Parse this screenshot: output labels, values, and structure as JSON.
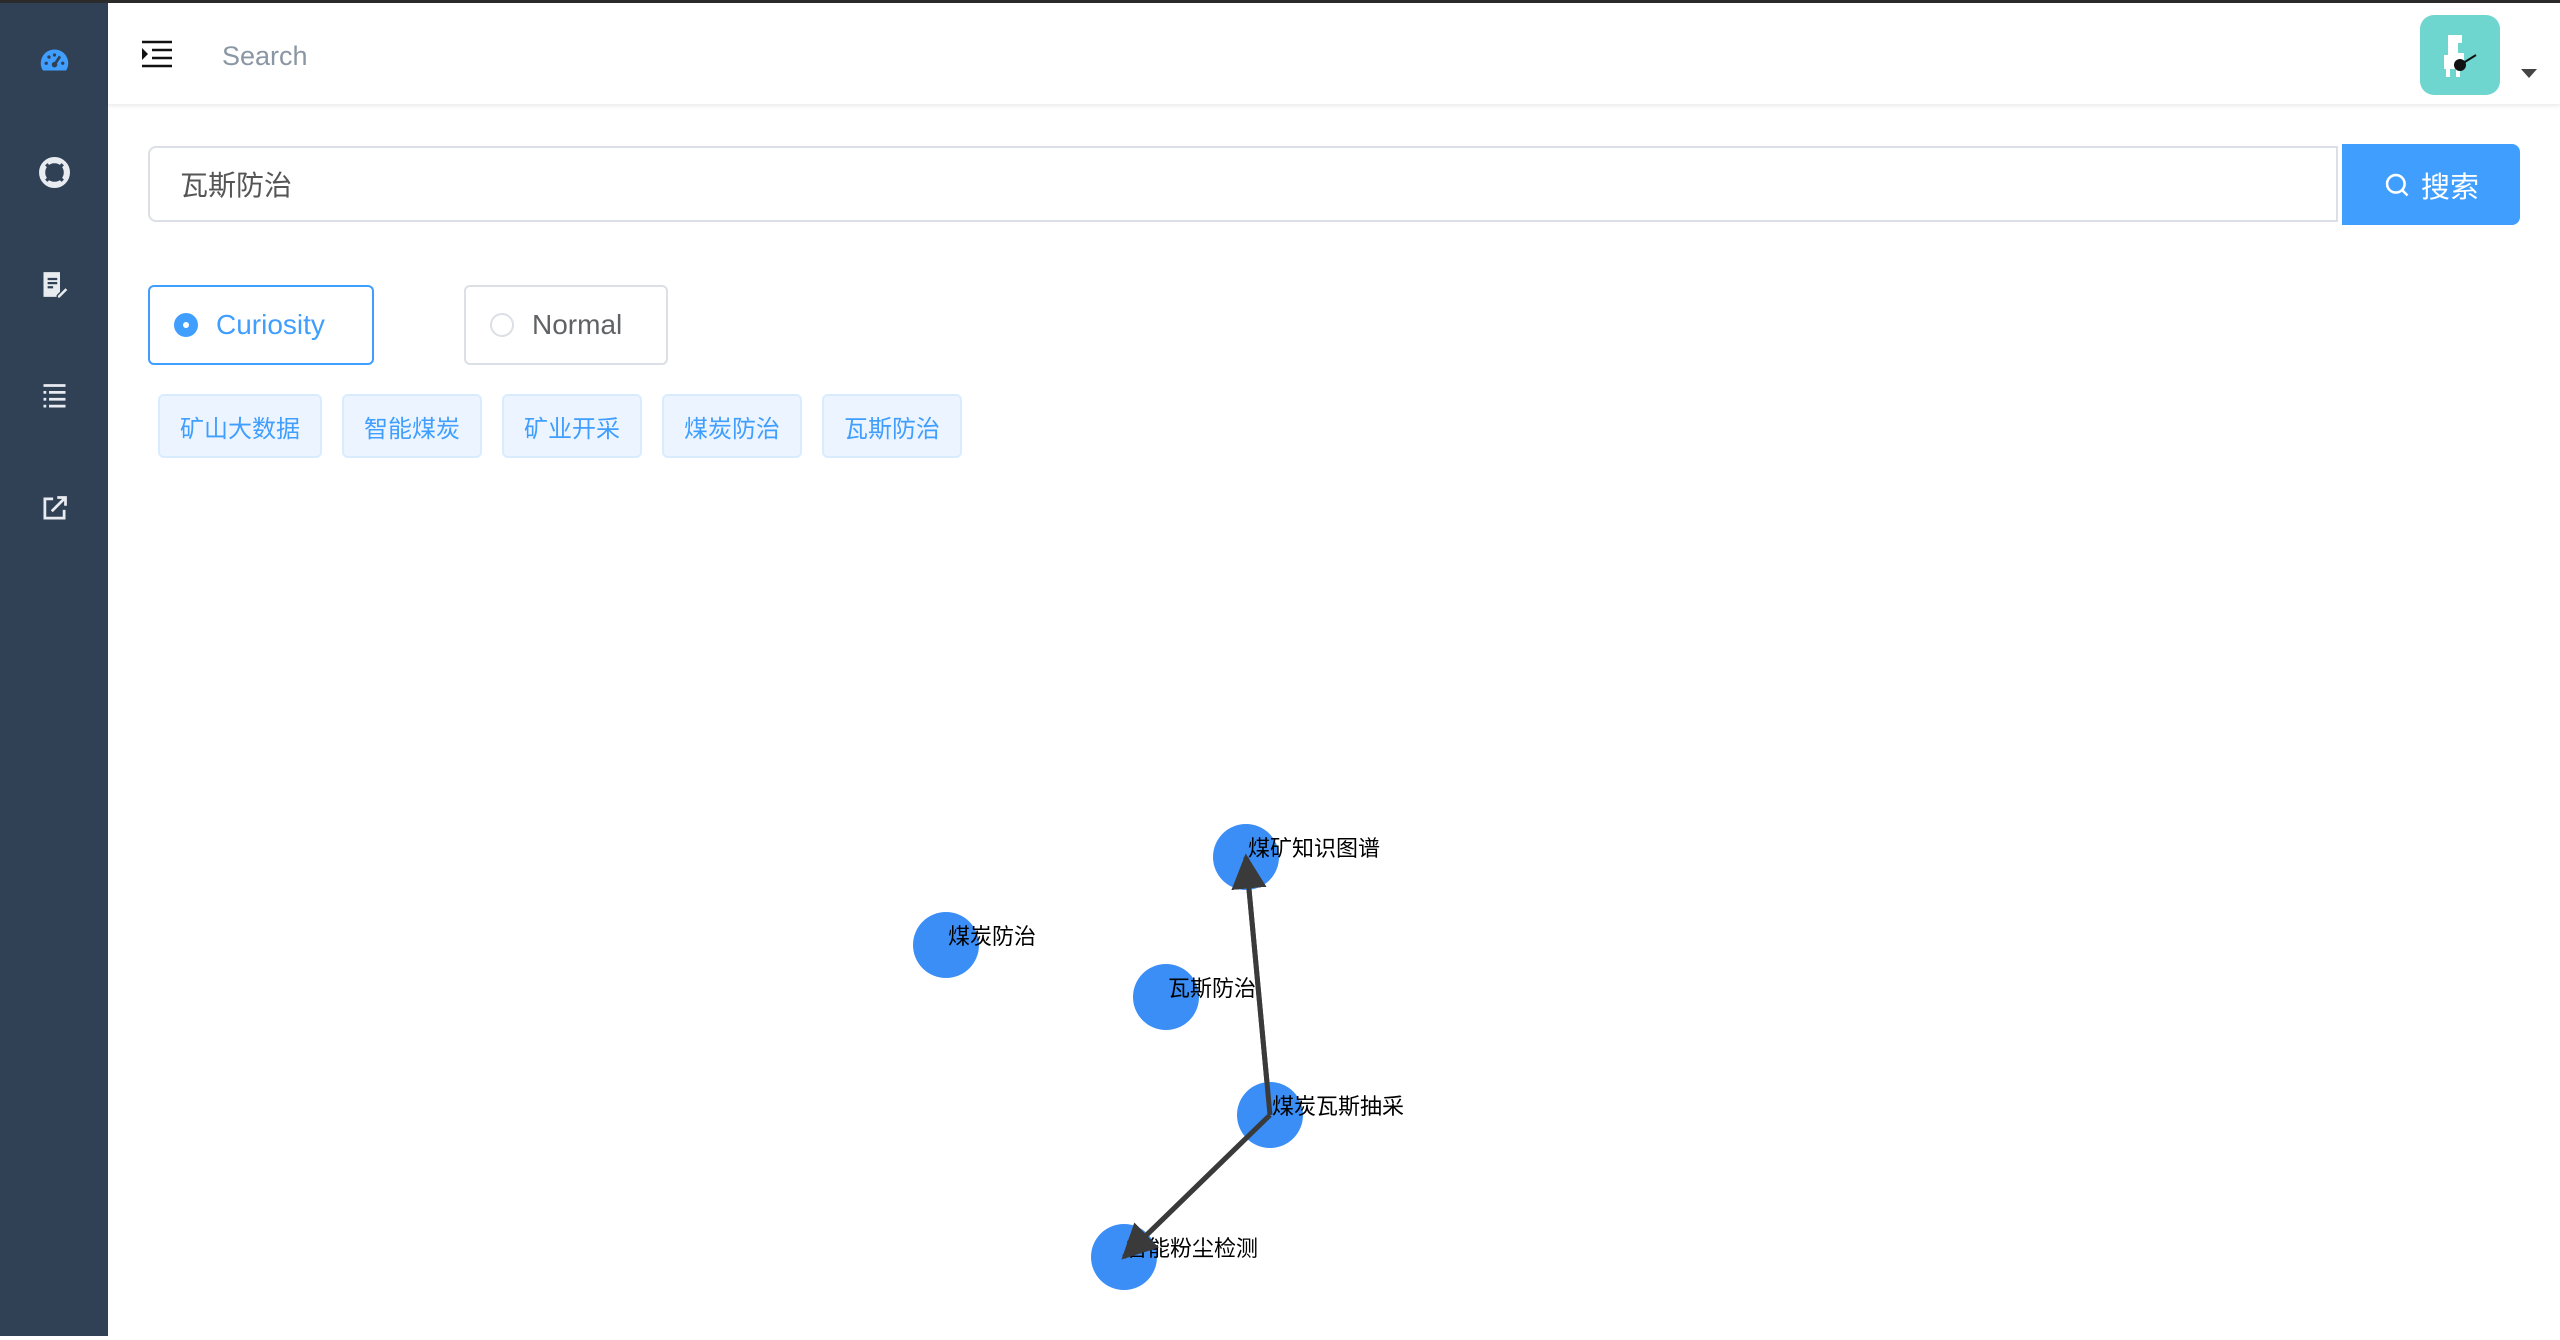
{
  "navbar": {
    "search_placeholder": "Search"
  },
  "sidebar": {
    "items": [
      {
        "icon": "dashboard-icon",
        "active": true
      },
      {
        "icon": "lifebuoy-icon",
        "active": false
      },
      {
        "icon": "document-edit-icon",
        "active": false
      },
      {
        "icon": "list-icon",
        "active": false
      },
      {
        "icon": "external-link-icon",
        "active": false
      }
    ]
  },
  "query": {
    "value": "瓦斯防治",
    "button_label": "搜索"
  },
  "modes": {
    "options": [
      {
        "label": "Curiosity",
        "checked": true
      },
      {
        "label": "Normal",
        "checked": false
      }
    ]
  },
  "tags": [
    "矿山大数据",
    "智能煤炭",
    "矿业开采",
    "煤炭防治",
    "瓦斯防治"
  ],
  "graph": {
    "nodes": [
      {
        "id": "n1",
        "label": "煤炭防治"
      },
      {
        "id": "n2",
        "label": "煤矿知识图谱"
      },
      {
        "id": "n3",
        "label": "瓦斯防治"
      },
      {
        "id": "n4",
        "label": "煤炭瓦斯抽采"
      },
      {
        "id": "n5",
        "label": "智能粉尘检测"
      }
    ],
    "edges": [
      {
        "from": "n4",
        "to": "n2"
      },
      {
        "from": "n4",
        "to": "n5"
      }
    ]
  },
  "colors": {
    "accent": "#409eff",
    "sidebar_bg": "#304156",
    "node": "#3a8ef6",
    "edge": "#3a3a3a"
  }
}
